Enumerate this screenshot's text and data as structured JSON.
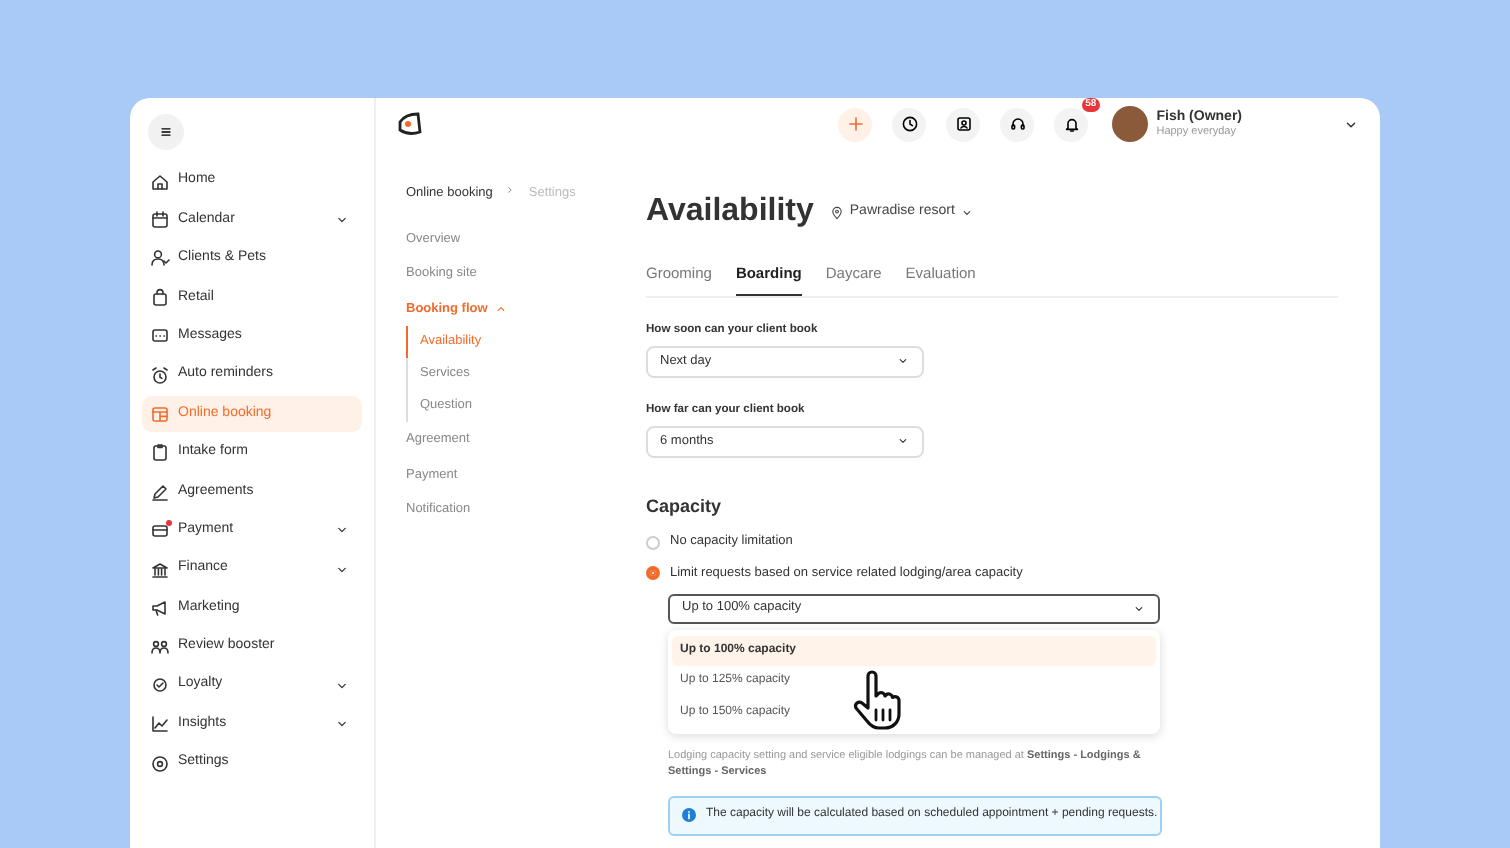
{
  "sidebar": {
    "items": [
      {
        "label": "Home",
        "selected": false,
        "has_submenu": false,
        "alert": false
      },
      {
        "label": "Calendar",
        "selected": false,
        "has_submenu": true,
        "alert": false
      },
      {
        "label": "Clients & Pets",
        "selected": false,
        "has_submenu": false,
        "alert": false
      },
      {
        "label": "Retail",
        "selected": false,
        "has_submenu": false,
        "alert": false
      },
      {
        "label": "Messages",
        "selected": false,
        "has_submenu": false,
        "alert": false
      },
      {
        "label": "Auto reminders",
        "selected": false,
        "has_submenu": false,
        "alert": false
      },
      {
        "label": "Online booking",
        "selected": true,
        "has_submenu": false,
        "alert": false
      },
      {
        "label": "Intake form",
        "selected": false,
        "has_submenu": false,
        "alert": false
      },
      {
        "label": "Agreements",
        "selected": false,
        "has_submenu": false,
        "alert": false
      },
      {
        "label": "Payment",
        "selected": false,
        "has_submenu": true,
        "alert": true
      },
      {
        "label": "Finance",
        "selected": false,
        "has_submenu": true,
        "alert": false
      },
      {
        "label": "Marketing",
        "selected": false,
        "has_submenu": false,
        "alert": false
      },
      {
        "label": "Review booster",
        "selected": false,
        "has_submenu": false,
        "alert": false
      },
      {
        "label": "Loyalty",
        "selected": false,
        "has_submenu": true,
        "alert": false
      },
      {
        "label": "Insights",
        "selected": false,
        "has_submenu": true,
        "alert": false
      },
      {
        "label": "Settings",
        "selected": false,
        "has_submenu": false,
        "alert": false
      }
    ]
  },
  "topbar": {
    "notification_count": "58",
    "user_name": "Fish (Owner)",
    "user_status": "Happy everyday"
  },
  "subnav": {
    "breadcrumb": [
      "Online booking",
      "Settings"
    ],
    "items": [
      {
        "label": "Overview",
        "selected": false
      },
      {
        "label": "Booking site",
        "selected": false
      },
      {
        "label": "Booking flow",
        "selected": true,
        "expanded": true,
        "children": [
          {
            "label": "Availability",
            "selected": true
          },
          {
            "label": "Services",
            "selected": false
          },
          {
            "label": "Question",
            "selected": false
          }
        ]
      },
      {
        "label": "Agreement",
        "selected": false
      },
      {
        "label": "Payment",
        "selected": false
      },
      {
        "label": "Notification",
        "selected": false
      }
    ]
  },
  "main": {
    "title": "Availability",
    "location": "Pawradise resort",
    "tabs": [
      {
        "label": "Grooming",
        "selected": false
      },
      {
        "label": "Boarding",
        "selected": true
      },
      {
        "label": "Daycare",
        "selected": false
      },
      {
        "label": "Evaluation",
        "selected": false
      }
    ],
    "fields": [
      {
        "label": "How soon can your client book",
        "value": "Next day"
      },
      {
        "label": "How far can your client book",
        "value": "6 months"
      }
    ],
    "capacity": {
      "heading": "Capacity",
      "options": [
        {
          "label": "No capacity limitation",
          "selected": false
        },
        {
          "label": "Limit requests based on service related lodging/area capacity",
          "selected": true
        }
      ],
      "select_value": "Up to 100% capacity",
      "dropdown": [
        {
          "label": "Up to 100% capacity",
          "selected": true
        },
        {
          "label": "Up to 125% capacity",
          "selected": false
        },
        {
          "label": "Up to 150% capacity",
          "selected": false
        }
      ],
      "note": "Lodging capacity setting and service eligible lodgings can be managed at **Settings - Lodgings & Settings - Services**",
      "info": "The capacity will be calculated based on scheduled appointment + pending requests."
    }
  }
}
